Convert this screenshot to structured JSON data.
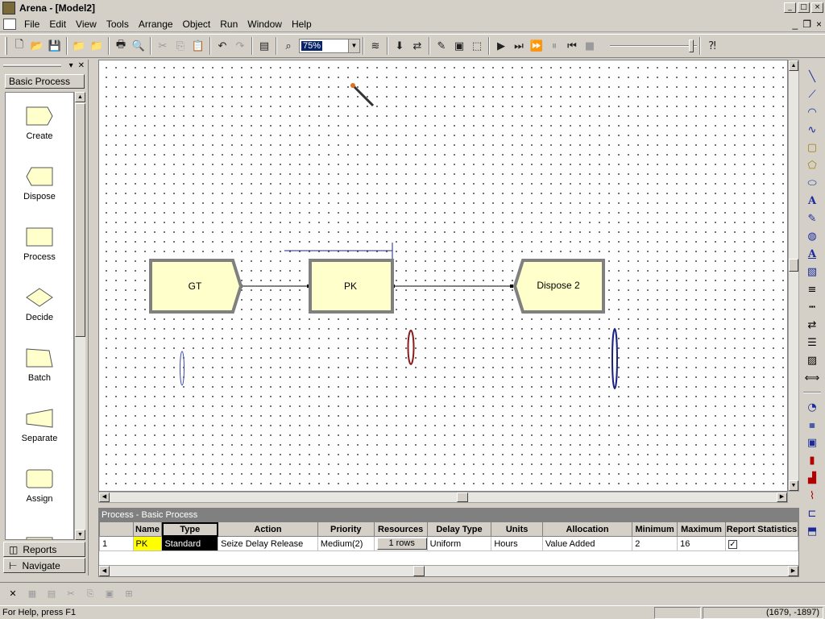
{
  "window": {
    "title": "Arena - [Model2]"
  },
  "menu": [
    "File",
    "Edit",
    "View",
    "Tools",
    "Arrange",
    "Object",
    "Run",
    "Window",
    "Help"
  ],
  "toolbar": {
    "zoom_value": "75%"
  },
  "project_bar": {
    "panel_title": "Basic Process",
    "modules": [
      "Create",
      "Dispose",
      "Process",
      "Decide",
      "Batch",
      "Separate",
      "Assign"
    ],
    "bottom_tabs": [
      "Reports",
      "Navigate"
    ]
  },
  "canvas": {
    "modules": [
      {
        "label": "GT",
        "kind": "create"
      },
      {
        "label": "PK",
        "kind": "process"
      },
      {
        "label": "Dispose 2",
        "kind": "dispose"
      }
    ]
  },
  "spreadsheet": {
    "title": "Process - Basic Process",
    "columns": [
      "Name",
      "Type",
      "Action",
      "Priority",
      "Resources",
      "Delay Type",
      "Units",
      "Allocation",
      "Minimum",
      "Maximum",
      "Report Statistics"
    ],
    "rows": [
      {
        "row_number": "1",
        "name": "PK",
        "type": "Standard",
        "action": "Seize Delay Release",
        "priority": "Medium(2)",
        "resources": "1 rows",
        "delay_type": "Uniform",
        "units": "Hours",
        "allocation": "Value Added",
        "minimum": "2",
        "maximum": "16",
        "report_statistics": true
      }
    ]
  },
  "status": {
    "help_text": "For Help, press F1",
    "coordinates": "(1679, -1897)"
  },
  "colors": {
    "module_fill": "#ffffcc",
    "module_border": "#808080",
    "name_cell": "#ffff00",
    "queue_blue": "#1a237e",
    "queue_red": "#8b1a1a"
  }
}
